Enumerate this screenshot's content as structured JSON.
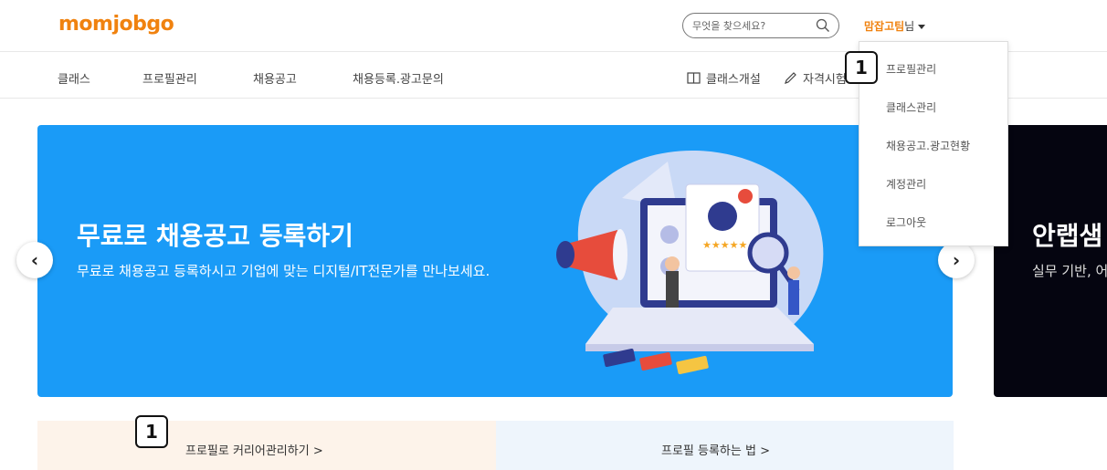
{
  "header": {
    "logo": "momjobgo",
    "search_placeholder": "무엇을 찾으세요?",
    "user_name": "맘잡고팀",
    "user_suffix": "님"
  },
  "nav": {
    "items": [
      {
        "label": "클래스"
      },
      {
        "label": "프로필관리"
      },
      {
        "label": "채용공고"
      },
      {
        "label": "채용등록.광고문의"
      }
    ],
    "right": [
      {
        "label": "클래스개설",
        "icon": "book-icon"
      },
      {
        "label": "자격시험",
        "icon": "pencil-icon"
      }
    ]
  },
  "dropdown": {
    "items": [
      {
        "label": "프로필관리"
      },
      {
        "label": "클래스관리"
      },
      {
        "label": "채용공고.광고현황"
      },
      {
        "label": "계정관리"
      },
      {
        "label": "로그아웃"
      }
    ]
  },
  "banner": {
    "title": "무료로 채용공고 등록하기",
    "subtitle": "무료로 채용공고 등록하시고 기업에 맞는 디지털/IT전문가를 만나보세요.",
    "prev": "‹",
    "next": "›"
  },
  "banner_next": {
    "title": "안랩샘",
    "subtitle": "실무 기반, 어 패스의 온"
  },
  "bottom": {
    "left": "프로필로 커리어관리하기 >",
    "right": "프로필 등록하는 법 >"
  },
  "annotations": {
    "badge_top": "1",
    "badge_bottom": "1"
  },
  "colors": {
    "brand_orange": "#f0820f",
    "banner_blue": "#1a9bf7"
  }
}
